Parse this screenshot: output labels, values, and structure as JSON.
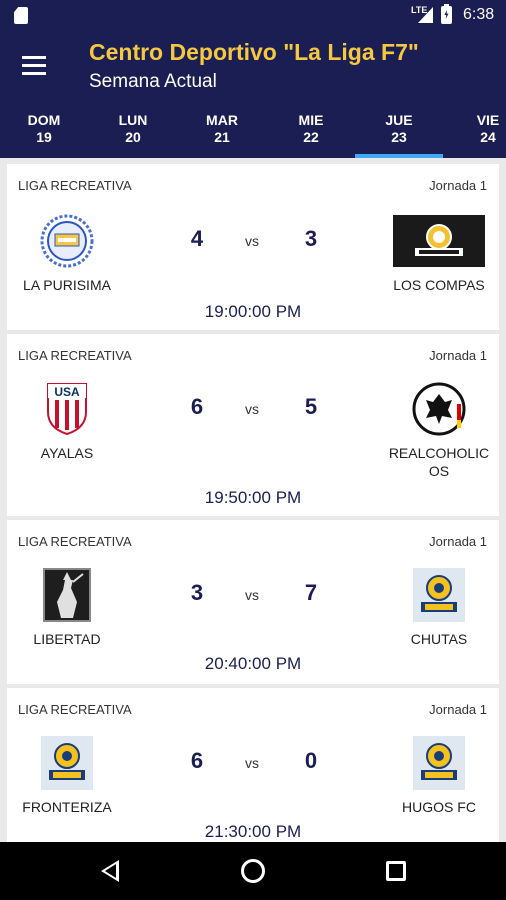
{
  "status": {
    "time": "6:38",
    "network": "LTE"
  },
  "header": {
    "title": "Centro Deportivo \"La Liga F7\"",
    "subtitle": "Semana Actual"
  },
  "days": [
    {
      "name": "DOM",
      "num": "19"
    },
    {
      "name": "LUN",
      "num": "20"
    },
    {
      "name": "MAR",
      "num": "21"
    },
    {
      "name": "MIE",
      "num": "22"
    },
    {
      "name": "JUE",
      "num": "23",
      "active": true
    },
    {
      "name": "VIE",
      "num": "24"
    }
  ],
  "matches": [
    {
      "league": "LIGA RECREATIVA",
      "jornada": "Jornada 1",
      "home": "LA PURISIMA",
      "home_score": "4",
      "vs": "vs",
      "away": "LOS COMPAS",
      "away_score": "3",
      "time": "19:00:00 PM"
    },
    {
      "league": "LIGA RECREATIVA",
      "jornada": "Jornada 1",
      "home": "AYALAS",
      "home_score": "6",
      "vs": "vs",
      "away": "REALCOHOLIC OS",
      "away_score": "5",
      "time": "19:50:00 PM"
    },
    {
      "league": "LIGA RECREATIVA",
      "jornada": "Jornada 1",
      "home": "LIBERTAD",
      "home_score": "3",
      "vs": "vs",
      "away": "CHUTAS",
      "away_score": "7",
      "time": "20:40:00 PM"
    },
    {
      "league": "LIGA RECREATIVA",
      "jornada": "Jornada 1",
      "home": "FRONTERIZA",
      "home_score": "6",
      "vs": "vs",
      "away": "HUGOS FC",
      "away_score": "0",
      "time": "21:30:00 PM"
    }
  ],
  "colors": {
    "primary": "#1b1e52",
    "title": "#f5c842",
    "tab_indicator": "#3fa9f5"
  },
  "icons": {
    "menu": "hamburger-icon",
    "back": "back-icon",
    "home": "home-icon",
    "recents": "recents-icon"
  }
}
